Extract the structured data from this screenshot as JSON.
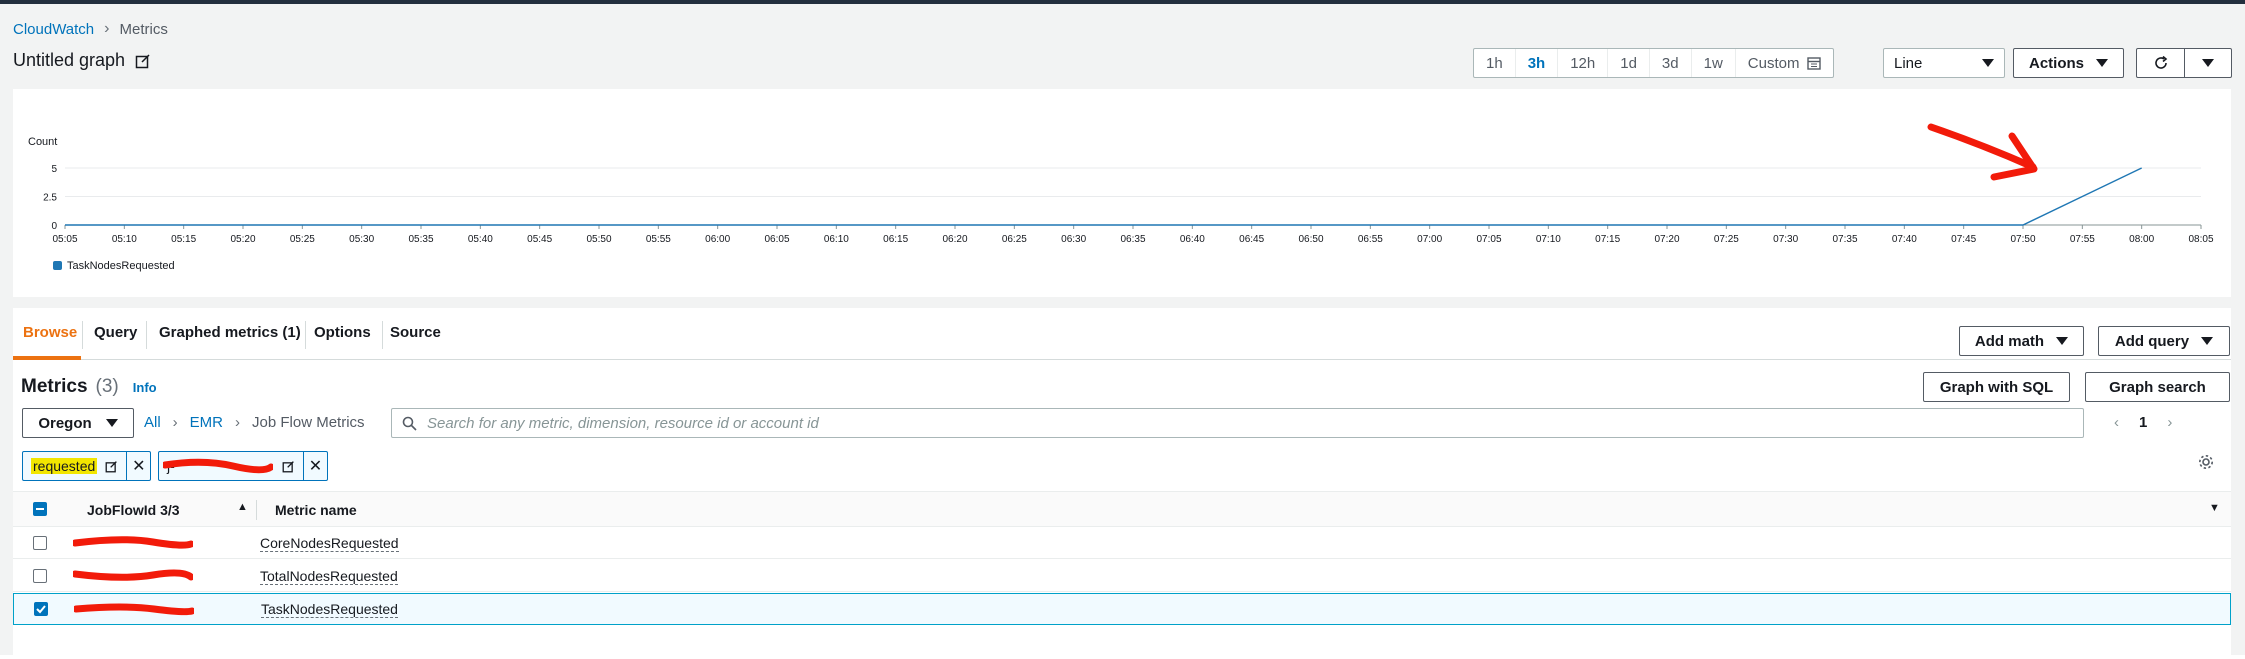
{
  "breadcrumb": {
    "root": "CloudWatch",
    "current": "Metrics"
  },
  "graph": {
    "title": "Untitled graph"
  },
  "time_ranges": [
    "1h",
    "3h",
    "12h",
    "1d",
    "3d",
    "1w",
    "Custom"
  ],
  "time_active": "3h",
  "graph_type": "Line",
  "actions_label": "Actions",
  "chart_data": {
    "type": "line",
    "ylabel": "Count",
    "y_ticks": [
      "5",
      "2.5",
      "0"
    ],
    "ylim": [
      0,
      5
    ],
    "x_ticks": [
      "05:05",
      "05:10",
      "05:15",
      "05:20",
      "05:25",
      "05:30",
      "05:35",
      "05:40",
      "05:45",
      "05:50",
      "05:55",
      "06:00",
      "06:05",
      "06:10",
      "06:15",
      "06:20",
      "06:25",
      "06:30",
      "06:35",
      "06:40",
      "06:45",
      "06:50",
      "06:55",
      "07:00",
      "07:05",
      "07:10",
      "07:15",
      "07:20",
      "07:25",
      "07:30",
      "07:35",
      "07:40",
      "07:45",
      "07:50",
      "07:55",
      "08:00",
      "08:05"
    ],
    "series": [
      {
        "name": "TaskNodesRequested",
        "color": "#1f77b4",
        "x": [
          "05:05",
          "07:50",
          "07:55",
          "08:00"
        ],
        "values": [
          0,
          0,
          2.5,
          5
        ]
      }
    ],
    "legend": "bottom-left",
    "grid": true
  },
  "tabs": [
    "Browse",
    "Query",
    "Graphed metrics (1)",
    "Options",
    "Source"
  ],
  "add_math": "Add math",
  "add_query": "Add query",
  "metrics_header": {
    "title": "Metrics",
    "count": "(3)",
    "info": "Info"
  },
  "graph_with_sql": "Graph with SQL",
  "graph_search": "Graph search",
  "region": "Oregon",
  "path": {
    "all": "All",
    "namespace": "EMR",
    "group": "Job Flow Metrics"
  },
  "search_placeholder": "Search for any metric, dimension, resource id or account id",
  "page_number": "1",
  "filters": {
    "term": "requested",
    "second": "j-"
  },
  "table": {
    "col_jobflow": "JobFlowId 3/3",
    "col_metric": "Metric name",
    "rows": [
      {
        "metric": "CoreNodesRequested",
        "checked": false
      },
      {
        "metric": "TotalNodesRequested",
        "checked": false
      },
      {
        "metric": "TaskNodesRequested",
        "checked": true
      }
    ]
  }
}
